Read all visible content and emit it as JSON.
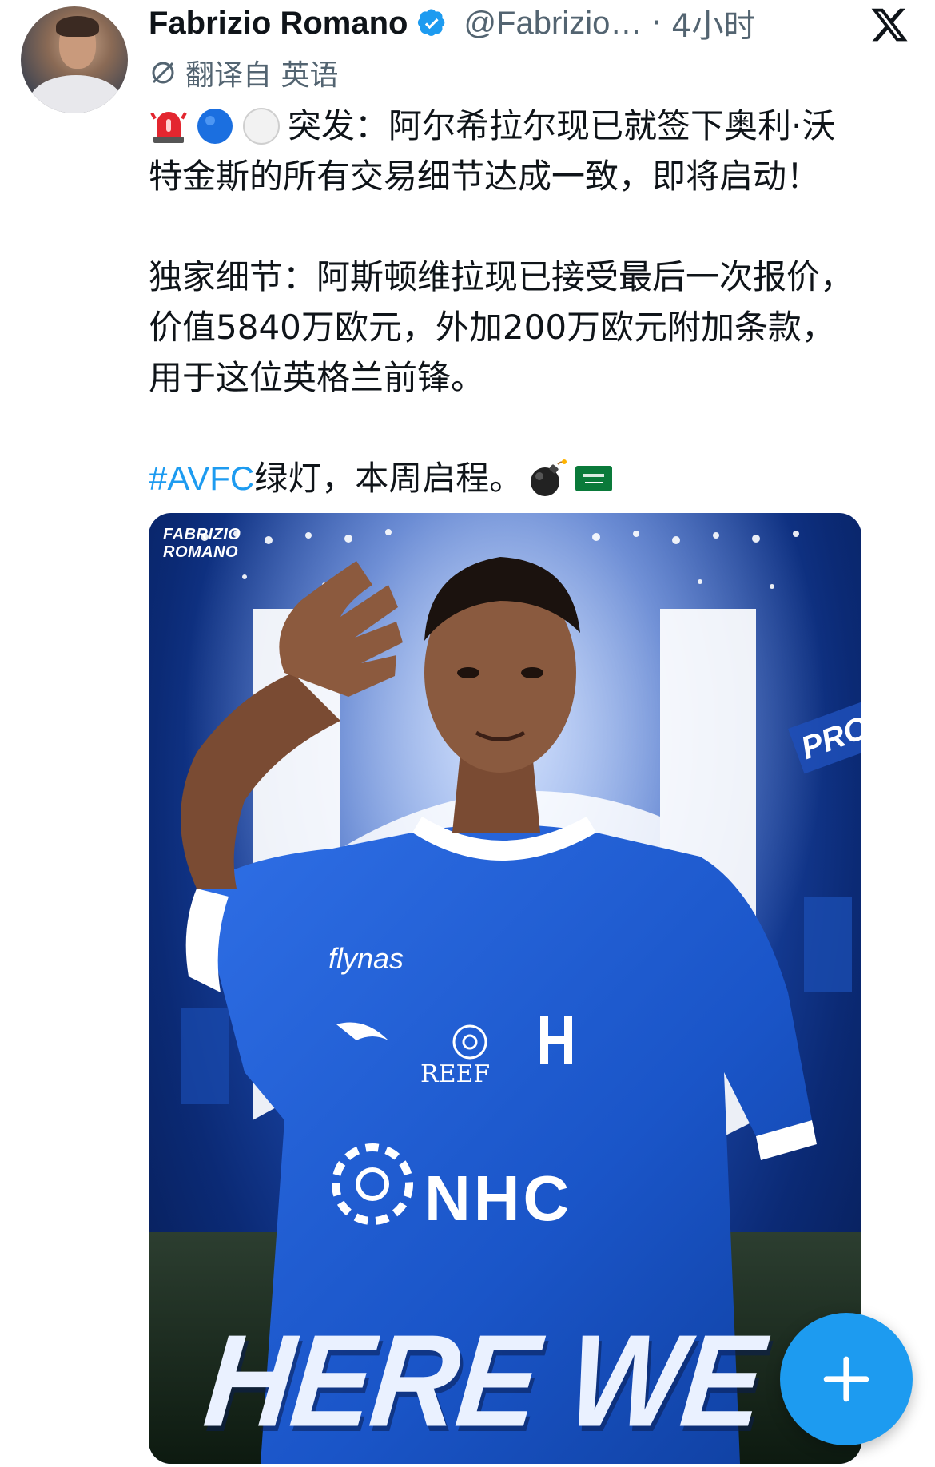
{
  "author": {
    "name": "Fabrizio Romano",
    "handle": "@Fabrizio…",
    "separator": "·",
    "timestamp": "4小时",
    "avatar_icon": "avatar-photo"
  },
  "translation": {
    "label": "翻译自 英语",
    "icon": "translate-icon"
  },
  "tweet": {
    "lines": [
      "突发：阿尔希拉尔现已就签下奥利·沃",
      "特金斯的所有交易细节达成一致，即将启动！",
      "独家细节：阿斯顿维拉现已接受最后一次报价，",
      "价值5840万欧元，外加200万欧元附加条款，",
      "用于这位英格兰前锋。"
    ],
    "hashtag": "#AVFC",
    "final_line_text": " 绿灯，本周启程。",
    "leading_emojis": [
      "rotating-light-emoji",
      "blue-circle-emoji",
      "white-circle-emoji"
    ],
    "trailing_emojis": [
      "bomb-emoji",
      "saudi-flag-emoji"
    ]
  },
  "media": {
    "watermark_line1": "FABRIZIO",
    "watermark_line2": "ROMANO",
    "slogan": "HERE WE GO",
    "sponsor_top": "flynas",
    "sponsor_mid": "REEF",
    "sponsor_main": "NHC",
    "stadium_banner": "PROU"
  },
  "colors": {
    "accent": "#1d9bf0",
    "text": "#0f1419",
    "muted": "#536471",
    "jersey": "#1f5fd6"
  },
  "icons": {
    "verified": "verified-badge-icon",
    "platform": "x-logo-icon",
    "compose": "plus-icon"
  }
}
